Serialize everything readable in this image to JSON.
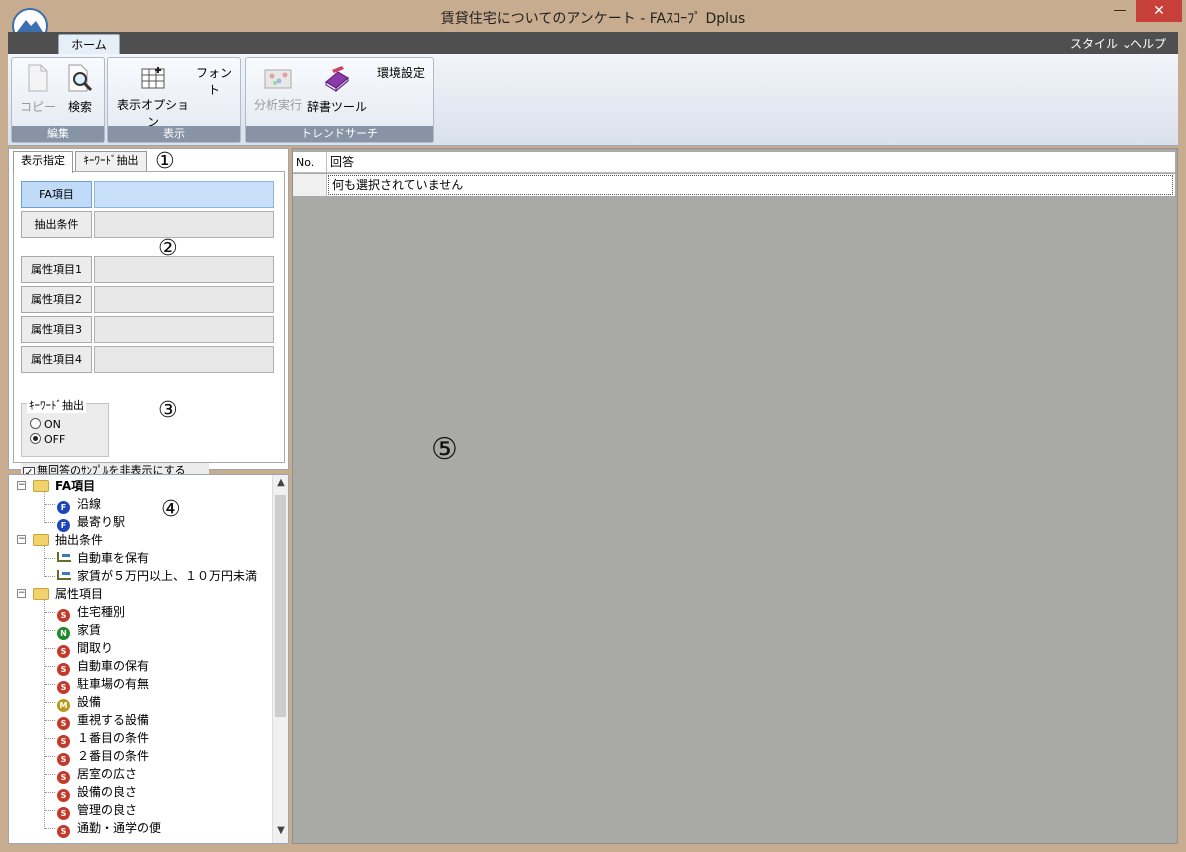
{
  "window": {
    "title": "賃貸住宅についてのアンケート - FAｽｺｰﾌﾟ Dplus",
    "minimize_glyph": "—",
    "maximize_glyph": "□",
    "close_glyph": "✕"
  },
  "menu": {
    "home_tab": "ホーム",
    "style": "スタイル ⌄",
    "help": "ヘルプ ⌄"
  },
  "ribbon": {
    "groups": [
      {
        "label": "編集",
        "buttons": [
          {
            "label": "コピー",
            "icon": "copy-icon",
            "enabled": false
          },
          {
            "label": "検索",
            "icon": "search-icon",
            "enabled": true
          }
        ]
      },
      {
        "label": "表示",
        "buttons": [
          {
            "label": "表示オプション",
            "icon": "table-icon",
            "enabled": true
          },
          {
            "label": "フォント",
            "enabled": true
          }
        ]
      },
      {
        "label": "トレンドサーチ",
        "buttons": [
          {
            "label": "分析実行",
            "icon": "analyze-icon",
            "enabled": false
          },
          {
            "label": "辞書ツール",
            "icon": "dictionary-icon",
            "enabled": true
          },
          {
            "label": "環境設定",
            "enabled": true
          }
        ]
      }
    ]
  },
  "left_tabs": [
    "表示指定",
    "ｷｰﾜｰﾄﾞ抽出"
  ],
  "fields": [
    {
      "label": "FA項目",
      "value": "",
      "selected": true
    },
    {
      "label": "抽出条件",
      "value": "",
      "selected": false
    },
    {
      "label": "属性項目1",
      "value": "",
      "selected": false
    },
    {
      "label": "属性項目2",
      "value": "",
      "selected": false
    },
    {
      "label": "属性項目3",
      "value": "",
      "selected": false
    },
    {
      "label": "属性項目4",
      "value": "",
      "selected": false
    }
  ],
  "keyword_extract": {
    "legend": "ｷｰﾜｰﾄﾞ抽出",
    "on_label": "ON",
    "off_label": "OFF",
    "selected": "OFF"
  },
  "hide_no_answer": {
    "label": "無回答のｻﾝﾌﾟﾙを非表示にする",
    "checked": true
  },
  "tree": [
    {
      "label": "FA項目",
      "level": 0,
      "type": "folder",
      "bold": true
    },
    {
      "label": "沿線",
      "level": 1,
      "type": "F"
    },
    {
      "label": "最寄り駅",
      "level": 1,
      "type": "F"
    },
    {
      "label": "抽出条件",
      "level": 0,
      "type": "folder"
    },
    {
      "label": "自動車を保有",
      "level": 1,
      "type": "cond"
    },
    {
      "label": "家賃が５万円以上、１０万円未満",
      "level": 1,
      "type": "cond"
    },
    {
      "label": "属性項目",
      "level": 0,
      "type": "folder"
    },
    {
      "label": "住宅種別",
      "level": 1,
      "type": "S"
    },
    {
      "label": "家賃",
      "level": 1,
      "type": "N"
    },
    {
      "label": "間取り",
      "level": 1,
      "type": "S"
    },
    {
      "label": "自動車の保有",
      "level": 1,
      "type": "S"
    },
    {
      "label": "駐車場の有無",
      "level": 1,
      "type": "S"
    },
    {
      "label": "設備",
      "level": 1,
      "type": "M"
    },
    {
      "label": "重視する設備",
      "level": 1,
      "type": "S"
    },
    {
      "label": "１番目の条件",
      "level": 1,
      "type": "S"
    },
    {
      "label": "２番目の条件",
      "level": 1,
      "type": "S"
    },
    {
      "label": "居室の広さ",
      "level": 1,
      "type": "S"
    },
    {
      "label": "設備の良さ",
      "level": 1,
      "type": "S"
    },
    {
      "label": "管理の良さ",
      "level": 1,
      "type": "S"
    },
    {
      "label": "通勤・通学の便",
      "level": 1,
      "type": "S"
    }
  ],
  "badge_letters": {
    "F": "F",
    "S": "S",
    "N": "N",
    "M": "M"
  },
  "grid": {
    "col_no": "No.",
    "col_answer": "回答",
    "empty_message": "何も選択されていません"
  },
  "callouts": [
    "①",
    "②",
    "③",
    "④",
    "⑤"
  ],
  "colors": {
    "frame": "#c8ac8f",
    "tabstrip": "#4f4f4f",
    "selected_field": "#bfdbf7",
    "grid_background": "#a9aaa6",
    "close_button": "#c7413a"
  }
}
